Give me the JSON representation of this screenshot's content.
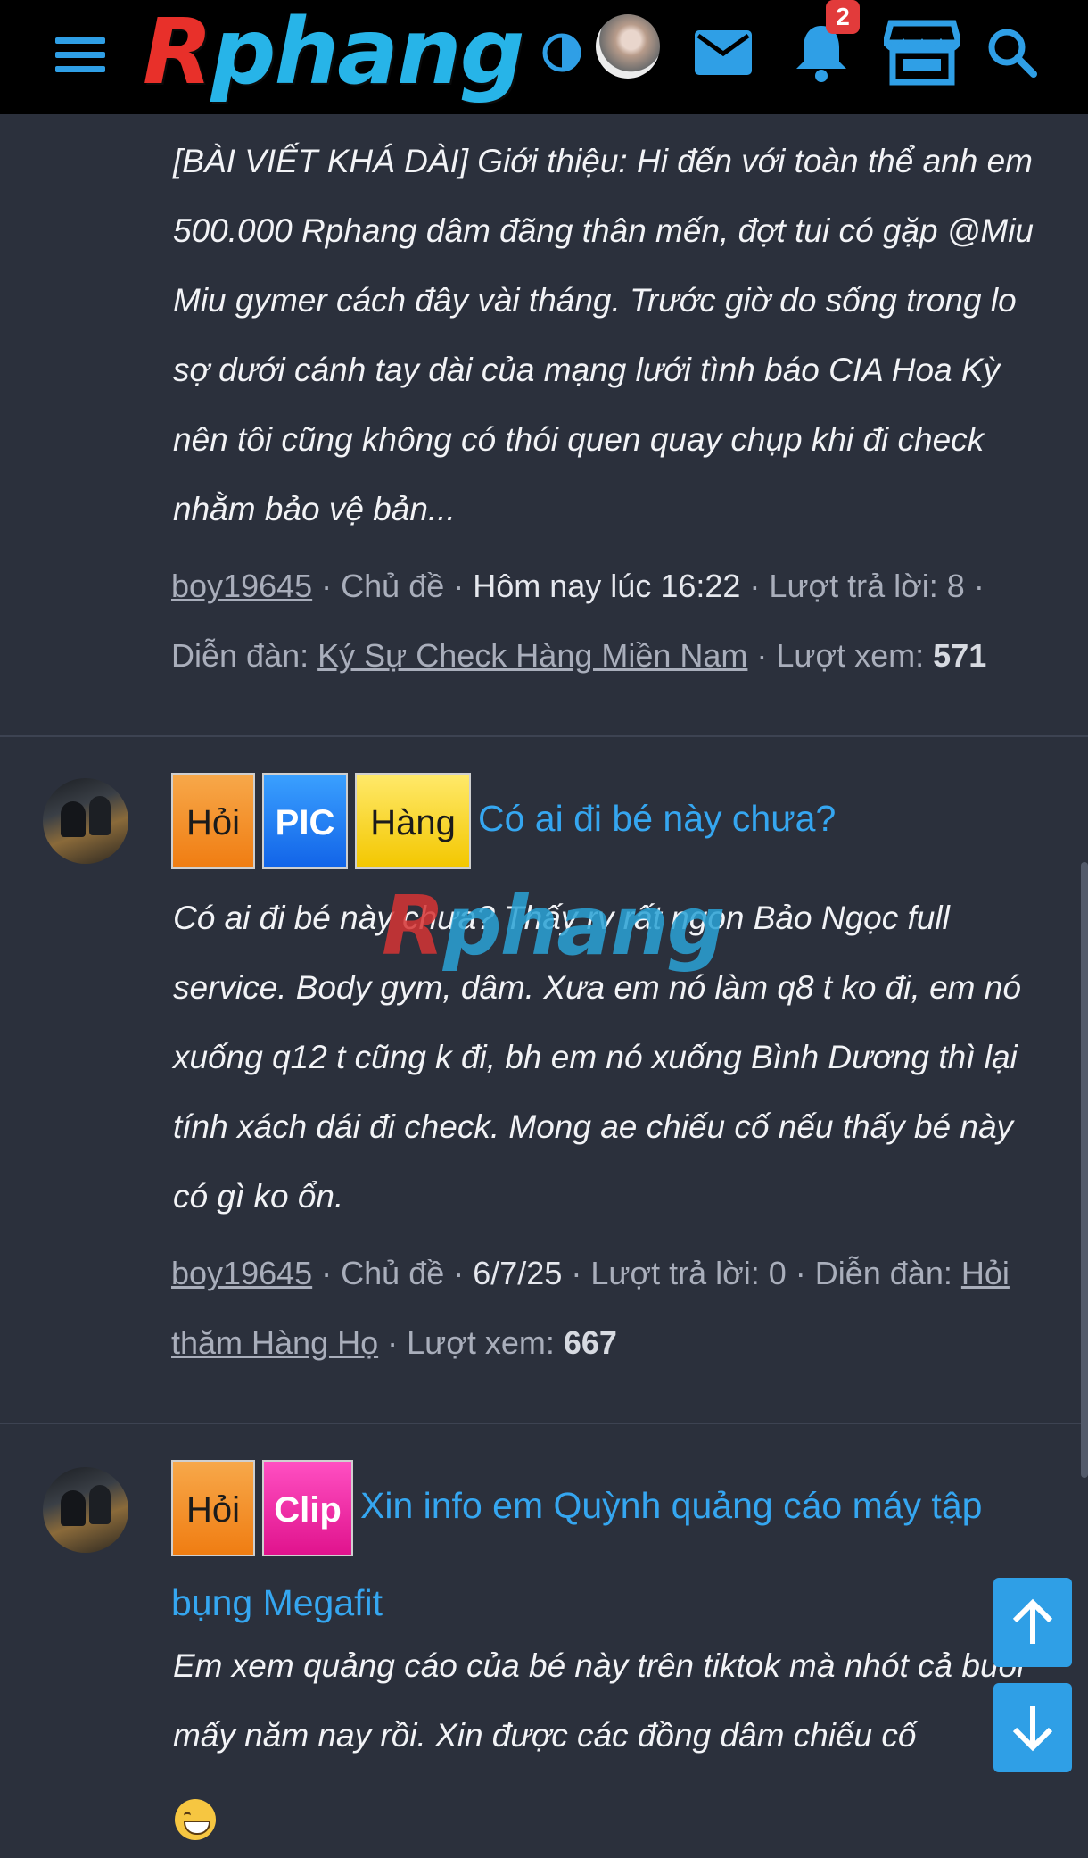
{
  "header": {
    "logo_first": "R",
    "logo_rest": "phang",
    "notification_count": "2",
    "icons": [
      "menu-icon",
      "theme-toggle-icon",
      "avatar",
      "mail-icon",
      "bell-icon",
      "store-icon",
      "search-icon"
    ]
  },
  "threads": [
    {
      "snippet": "[BÀI VIẾT KHÁ DÀI] Giới thiệu: Hi đến với toàn thể anh em 500.000 Rphang dâm đãng thân mến, đợt tui có gặp @Miu Miu gymer cách đây vài tháng. Trước giờ do sống trong lo sợ dưới cánh tay dài của mạng lưới tình báo CIA Hoa Kỳ nên tôi cũng không có thói quen quay chụp khi đi check nhằm bảo vệ bản...",
      "author": "boy19645",
      "type": "Chủ đề",
      "time": "Hôm nay lúc 16:22",
      "replies_label": "Lượt trả lời:",
      "replies": "8",
      "forum_label": "Diễn đàn:",
      "forum": "Ký Sự Check Hàng Miền Nam",
      "views_label": "Lượt xem:",
      "views": "571"
    },
    {
      "tags": [
        "Hỏi",
        "PIC",
        "Hàng"
      ],
      "title": "Có ai đi bé này chưa?",
      "snippet": "Có ai đi bé này chưa? Thấy rv rất ngon Bảo Ngọc full service. Body gym, dâm. Xưa em nó làm q8 t ko đi, em nó xuống q12 t cũng k đi, bh em nó xuống Bình Dương thì lại tính xách dái đi check. Mong ae chiếu cố nếu thấy bé này có gì ko ổn.",
      "author": "boy19645",
      "type": "Chủ đề",
      "time": "6/7/25",
      "replies_label": "Lượt trả lời:",
      "replies": "0",
      "forum_label": "Diễn đàn:",
      "forum": "Hỏi thăm Hàng Họ",
      "views_label": "Lượt xem:",
      "views": "667"
    },
    {
      "tags": [
        "Hỏi",
        "Clip"
      ],
      "title_line1": "Xin info em Quỳnh quảng cáo máy tập",
      "title_line2": "bụng Megafit",
      "snippet": "Em xem quảng cáo của bé này trên tiktok mà nhót cả buổi mấy năm nay rồi. Xin được các đồng dâm chiếu cố"
    }
  ],
  "watermark": {
    "first": "R",
    "rest": "phang"
  },
  "fab": {
    "up": "scroll-up",
    "down": "scroll-down"
  }
}
